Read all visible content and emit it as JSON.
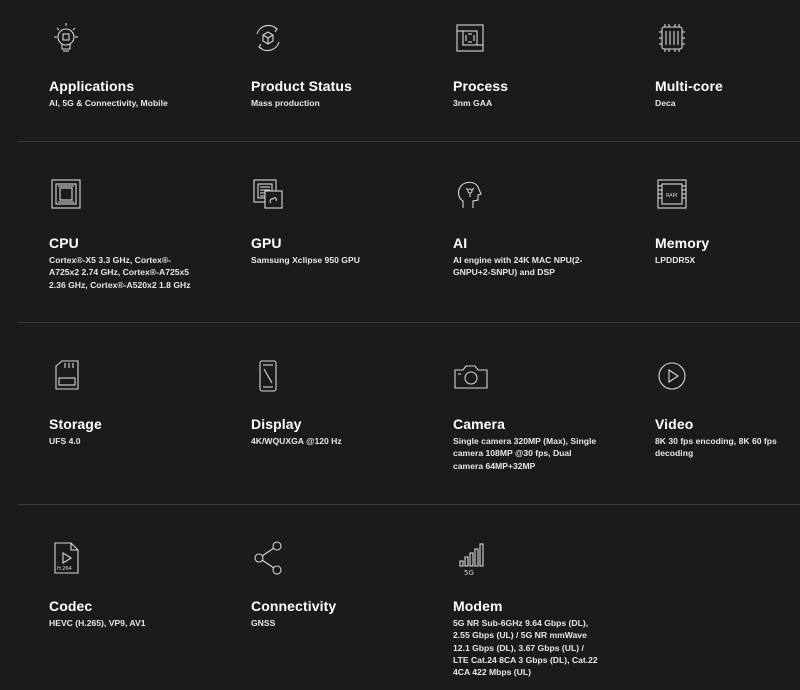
{
  "rows": [
    {
      "items": [
        {
          "title": "Applications",
          "value": "AI, 5G & Connectivity, Mobile",
          "icon": "lightbulb-chip-icon"
        },
        {
          "title": "Product Status",
          "value": "Mass production",
          "icon": "cycle-cube-icon"
        },
        {
          "title": "Process",
          "value": "3nm GAA",
          "icon": "chip-process-icon"
        },
        {
          "title": "Multi-core",
          "value": "Deca",
          "icon": "multicore-chip-icon"
        }
      ]
    },
    {
      "items": [
        {
          "title": "CPU",
          "value": "Cortex®-X5 3.3 GHz, Cortex®-A725x2 2.74 GHz, Cortex®-A725x5 2.36 GHz, Cortex®-A520x2 1.8 GHz",
          "icon": "cpu-icon"
        },
        {
          "title": "GPU",
          "value": "Samsung Xclipse 950 GPU",
          "icon": "gpu-icon"
        },
        {
          "title": "AI",
          "value": "AI engine with 24K MAC NPU(2-GNPU+2-SNPU) and DSP",
          "icon": "ai-head-icon"
        },
        {
          "title": "Memory",
          "value": "LPDDR5X",
          "icon": "ram-icon"
        }
      ]
    },
    {
      "items": [
        {
          "title": "Storage",
          "value": "UFS 4.0",
          "icon": "sd-card-icon"
        },
        {
          "title": "Display",
          "value": "4K/WQUXGA @120 Hz",
          "icon": "phone-display-icon"
        },
        {
          "title": "Camera",
          "value": "Single camera 320MP (Max), Single camera 108MP @30 fps, Dual camera 64MP+32MP",
          "icon": "camera-icon"
        },
        {
          "title": "Video",
          "value": "8K 30 fps encoding, 8K 60 fps decoding",
          "icon": "play-circle-icon"
        }
      ]
    },
    {
      "items": [
        {
          "title": "Codec",
          "value": "HEVC (H.265), VP9, AV1",
          "icon": "h264-file-icon",
          "icon_text": "H.264"
        },
        {
          "title": "Connectivity",
          "value": "GNSS",
          "icon": "share-nodes-icon"
        },
        {
          "title": "Modem",
          "value": "5G NR Sub-6GHz 9.64 Gbps (DL), 2.55 Gbps (UL) / 5G NR mmWave 12.1 Gbps (DL), 3.67 Gbps (UL) / LTE Cat.24 8CA 3 Gbps (DL), Cat.22 4CA 422 Mbps (UL)",
          "icon": "5g-signal-icon",
          "icon_text": "5G"
        }
      ]
    }
  ],
  "ram_icon_text": "RAM"
}
